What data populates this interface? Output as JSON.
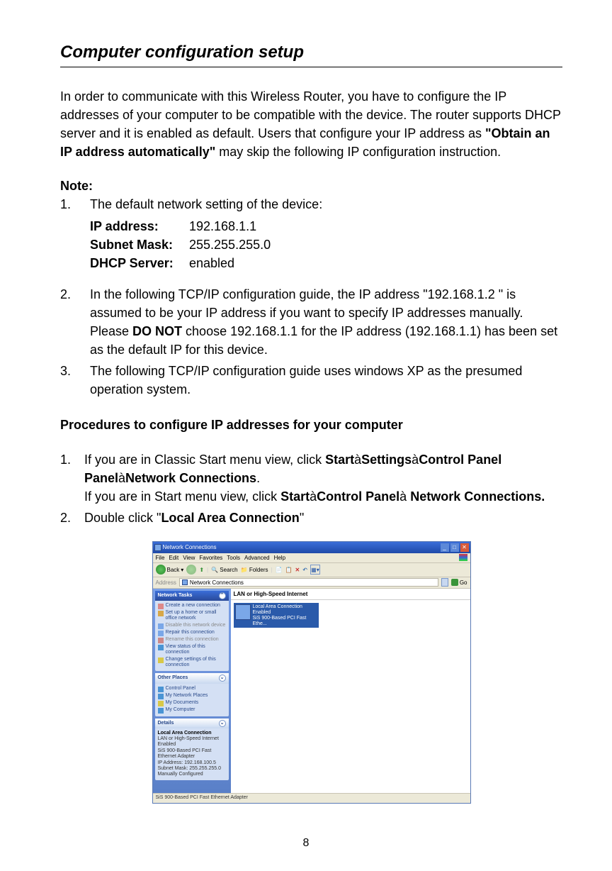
{
  "title": "Computer configuration setup",
  "intro_p1": "In order to communicate with this Wireless Router, you have to configure the IP addresses of your computer to be compatible with the device. The router supports DHCP server and it is enabled as default. Users that configure your IP address as ",
  "intro_bold": "\"Obtain an IP address automatically\"",
  "intro_p2": " may skip the following IP configuration instruction.",
  "note_label": "Note:",
  "note1": {
    "num": "1.",
    "text": "The default network setting of the device:",
    "kv": [
      {
        "k": "IP address:",
        "v": "192.168.1.1"
      },
      {
        "k": "Subnet Mask:",
        "v": "255.255.255.0"
      },
      {
        "k": "DHCP Server:",
        "v": "enabled"
      }
    ]
  },
  "note2": {
    "num": "2.",
    "t1": "In the following TCP/IP configuration guide, the IP address \"192.168.1.2 \" is assumed to be your IP address if you want to specify IP addresses manually. Please ",
    "bold": "DO NOT",
    "t2": " choose 192.168.1.1 for the IP address (192.168.1.1) has been set as the default IP for this device."
  },
  "note3": {
    "num": "3.",
    "text": "The following TCP/IP configuration guide uses windows XP as the presumed operation system."
  },
  "proc_title": "Procedures to configure IP addresses for your computer",
  "proc1": {
    "num": "1.",
    "a1": "If you are in Classic Start menu view, click ",
    "a_bold1": "Start",
    "arrow": "à",
    "a_bold2": "Settings",
    "a_bold3": "Control Panel",
    "a_bold4": "Network Connections",
    "period": ".",
    "b1": "If you are in Start menu view, click ",
    "b_bold1": "Start",
    "b_bold2": "Control Panel",
    "b_bold3": " Network Connections."
  },
  "proc2": {
    "num": "2.",
    "t1": "Double click \"",
    "bold": "Local Area Connection",
    "t2": "\""
  },
  "screenshot": {
    "window_title": "Network Connections",
    "menu": [
      "File",
      "Edit",
      "View",
      "Favorites",
      "Tools",
      "Advanced",
      "Help"
    ],
    "toolbar": {
      "back": "Back",
      "search": "Search",
      "folders": "Folders"
    },
    "address_label": "Address",
    "address_value": "Network Connections",
    "go": "Go",
    "section": "LAN or High-Speed Internet",
    "lan_item": {
      "l1": "Local Area Connection",
      "l2": "Enabled",
      "l3": "SiS 900-Based PCI Fast Ethe..."
    },
    "tasks": {
      "title": "Network Tasks",
      "items": [
        {
          "t": "Create a new connection",
          "c": "#d88"
        },
        {
          "t": "Set up a home or small office network",
          "c": "#d8a848"
        },
        {
          "t": "Disable this network device",
          "c": "#7aa7e8",
          "dis": true
        },
        {
          "t": "Repair this connection",
          "c": "#7aa7e8"
        },
        {
          "t": "Rename this connection",
          "c": "#c88",
          "dis": true
        },
        {
          "t": "View status of this connection",
          "c": "#4a94d4"
        },
        {
          "t": "Change settings of this connection",
          "c": "#d8c848"
        }
      ]
    },
    "other": {
      "title": "Other Places",
      "items": [
        {
          "t": "Control Panel",
          "c": "#4a94d4"
        },
        {
          "t": "My Network Places",
          "c": "#4a94d4"
        },
        {
          "t": "My Documents",
          "c": "#d8c848"
        },
        {
          "t": "My Computer",
          "c": "#4a94d4"
        }
      ]
    },
    "details": {
      "title": "Details",
      "h": "Local Area Connection",
      "lines": [
        "LAN or High-Speed Internet",
        "Enabled",
        "SiS 900-Based PCI Fast Ethernet Adapter",
        "IP Address: 192.168.100.5",
        "Subnet Mask: 255.255.255.0",
        "Manually Configured"
      ]
    },
    "status": "SiS 900-Based PCI Fast Ethernet Adapter"
  },
  "page_num": "8"
}
